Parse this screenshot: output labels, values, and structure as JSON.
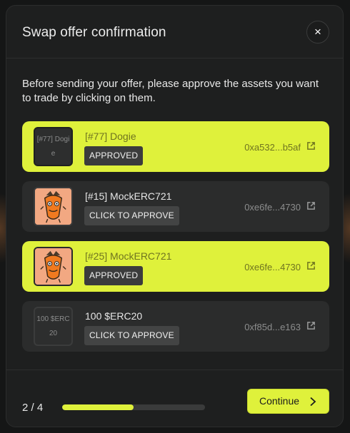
{
  "modal": {
    "title": "Swap offer confirmation",
    "close_label": "×",
    "instructions": "Before sending your offer, please approve the assets you want to trade by clicking on them."
  },
  "assets": [
    {
      "name": "[#77] Dogie",
      "thumb_text": "[#77] Dogie",
      "thumb_kind": "placeholder",
      "status": "APPROVED",
      "approved": true,
      "address": "0xa532...b5af"
    },
    {
      "name": "[#15] MockERC721",
      "thumb_kind": "image",
      "status": "CLICK TO APPROVE",
      "approved": false,
      "address": "0xe6fe...4730"
    },
    {
      "name": "[#25] MockERC721",
      "thumb_kind": "image",
      "status": "APPROVED",
      "approved": true,
      "address": "0xe6fe...4730"
    },
    {
      "name": "100 $ERC20",
      "thumb_text": "100 $ERC20",
      "thumb_kind": "placeholder",
      "status": "CLICK TO APPROVE",
      "approved": false,
      "address": "0xf85d...e163"
    }
  ],
  "footer": {
    "step_text": "2 / 4",
    "progress_fraction": 0.5,
    "continue_label": "Continue"
  },
  "colors": {
    "accent": "#dff13b",
    "modal_bg": "#1e1f1f",
    "card_pending": "#2b2c2c"
  },
  "icons": {
    "close": "close-icon",
    "external": "external-link-icon",
    "next": "chevron-right-icon",
    "nft_art": "orange-character-icon"
  }
}
